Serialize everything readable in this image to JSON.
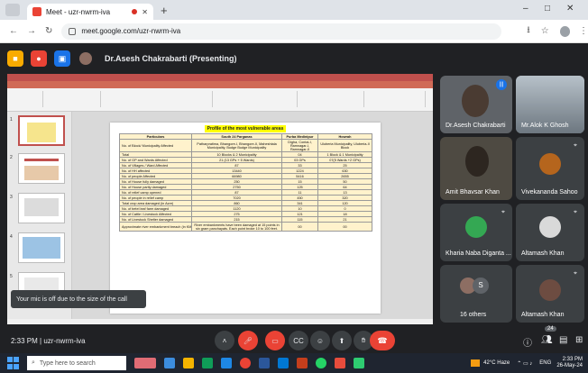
{
  "browser": {
    "tab_title": "Meet - uzr-nwrm-iva",
    "new_tab": "+",
    "url": "meet.google.com/uzr-nwrm-iva",
    "minimize": "–",
    "maximize": "□",
    "close": "✕"
  },
  "meet": {
    "presenting_label": "Dr.Asesh Chakrabarti (Presenting)",
    "clock": "2:33 PM",
    "meeting_code": "uzr-nwrm-iva",
    "clock_full": "2:33 PM | uzr-nwrm-iva",
    "mic_toast": "Your mic is off due to the size of the call",
    "participants_count": "24"
  },
  "slide": {
    "title": "Profile of the most vulnerable areas",
    "headers": [
      "Particulars",
      "South 24 Parganas",
      "Purba Medinipur",
      "Howrah"
    ],
    "rows": [
      [
        "No. of Block/ Municipality Affected",
        "Patharpratima, Bhangore-I, Bhangore-II, Maheshtala Municipality, Budge Budge Municipality",
        "Digha, Contai-I, Ramnagar-I, Ramnagar-II",
        "Uluberia Municipality, Uluberia-II Block"
      ],
      [
        "Total",
        "10 Blocks & 2 Municipality",
        "04",
        "1 Block & 1 Municipality"
      ],
      [
        "No. of GP and Wards Affected",
        "21 (13 GPs + 5 Wards)",
        "03 GPs",
        "07(5 Wards +2 GPs)"
      ],
      [
        "No. of Villages / Ward Affected",
        "87",
        "33",
        "25"
      ],
      [
        "No. of HH affected",
        "13440",
        "1224",
        "630"
      ],
      [
        "No. of people Affected",
        "66980",
        "5416",
        "2655"
      ],
      [
        "No. of House fully damaged",
        "250",
        "15",
        "50"
      ],
      [
        "No. of House partly damaged",
        "2750",
        "125",
        "64"
      ],
      [
        "No. of relief camp opened",
        "87",
        "11",
        "13"
      ],
      [
        "No. of people in relief camp",
        "7020",
        "450",
        "320"
      ],
      [
        "Total crop area damaged (in Acre)",
        "860",
        "341",
        "120"
      ],
      [
        "No. of betel leaf farm damaged",
        "1120",
        "10",
        "0"
      ],
      [
        "No. of Cattle / Livestock Affected",
        "275",
        "121",
        "18"
      ],
      [
        "No. of Livestock Shelter damaged",
        "215",
        "115",
        "21"
      ],
      [
        "Approximate river embankment breach (in KM)",
        "River embankments have been damaged at 15 points in six gram panchayats. Each point broke 10 to 100 feet.",
        "00",
        "00"
      ]
    ]
  },
  "tiles": [
    {
      "name": "Dr.Asesh Chakrabarti",
      "color": "#5f6368"
    },
    {
      "name": "Mr.Alok K Ghosh",
      "color": "#8a9199"
    },
    {
      "name": "Amit Bhavsar Khan",
      "color": "#4e4a42"
    },
    {
      "name": "Vivekananda Sahoo",
      "color": "#3c4043"
    },
    {
      "name": "Kharia Naba Diganta ...",
      "color": "#3c4043"
    },
    {
      "name": "Altamash Khan",
      "color": "#3c4043"
    },
    {
      "name": "16 others",
      "color": "#3c4043"
    },
    {
      "name": "Altamash Khan",
      "color": "#3c4043"
    }
  ],
  "taskbar": {
    "search_placeholder": "Type here to search",
    "weather": "42°C Haze",
    "time": "2:33 PM",
    "date": "26-May-24",
    "lang": "ENG"
  },
  "colors": {
    "accent": "#1a73e8",
    "danger": "#ea4335",
    "ppt": "#c0504d",
    "highlight": "#ffff00"
  }
}
